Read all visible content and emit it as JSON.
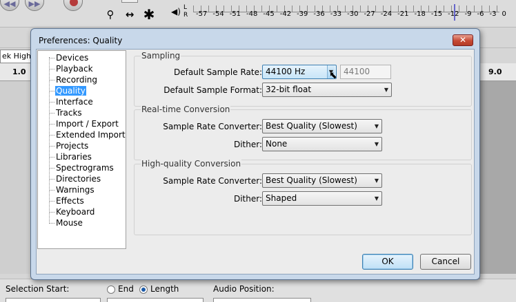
{
  "app": {
    "meter_channels": [
      "L",
      "R"
    ],
    "meter_scale": [
      "-57",
      "-54",
      "-51",
      "-48",
      "-45",
      "-42",
      "-39",
      "-36",
      "-33",
      "-30",
      "-27",
      "-24",
      "-21",
      "-18",
      "-15",
      "-12",
      "-9",
      "-6",
      "-3",
      "0"
    ],
    "quality_label": "ek High I",
    "ruler_left": "1.0",
    "ruler_right": "9.0",
    "selection_start_label": "Selection Start:",
    "end_label": "End",
    "length_label": "Length",
    "audio_position_label": "Audio Position:"
  },
  "dialog": {
    "title": "Preferences: Quality",
    "close_glyph": "✕",
    "nav": [
      {
        "label": "Devices",
        "selected": false
      },
      {
        "label": "Playback",
        "selected": false
      },
      {
        "label": "Recording",
        "selected": false
      },
      {
        "label": "Quality",
        "selected": true
      },
      {
        "label": "Interface",
        "selected": false
      },
      {
        "label": "Tracks",
        "selected": false
      },
      {
        "label": "Import / Export",
        "selected": false
      },
      {
        "label": "Extended Import",
        "selected": false
      },
      {
        "label": "Projects",
        "selected": false
      },
      {
        "label": "Libraries",
        "selected": false
      },
      {
        "label": "Spectrograms",
        "selected": false
      },
      {
        "label": "Directories",
        "selected": false
      },
      {
        "label": "Warnings",
        "selected": false
      },
      {
        "label": "Effects",
        "selected": false
      },
      {
        "label": "Keyboard",
        "selected": false
      },
      {
        "label": "Mouse",
        "selected": false
      }
    ],
    "sampling": {
      "title": "Sampling",
      "rate_label": "Default Sample Rate:",
      "rate_value": "44100 Hz",
      "rate_custom": "44100",
      "format_label": "Default Sample Format:",
      "format_value": "32-bit float"
    },
    "realtime": {
      "title": "Real-time Conversion",
      "converter_label": "Sample Rate Converter:",
      "converter_value": "Best Quality (Slowest)",
      "dither_label": "Dither:",
      "dither_value": "None"
    },
    "highquality": {
      "title": "High-quality Conversion",
      "converter_label": "Sample Rate Converter:",
      "converter_value": "Best Quality (Slowest)",
      "dither_label": "Dither:",
      "dither_value": "Shaped"
    },
    "ok_label": "OK",
    "cancel_label": "Cancel"
  }
}
